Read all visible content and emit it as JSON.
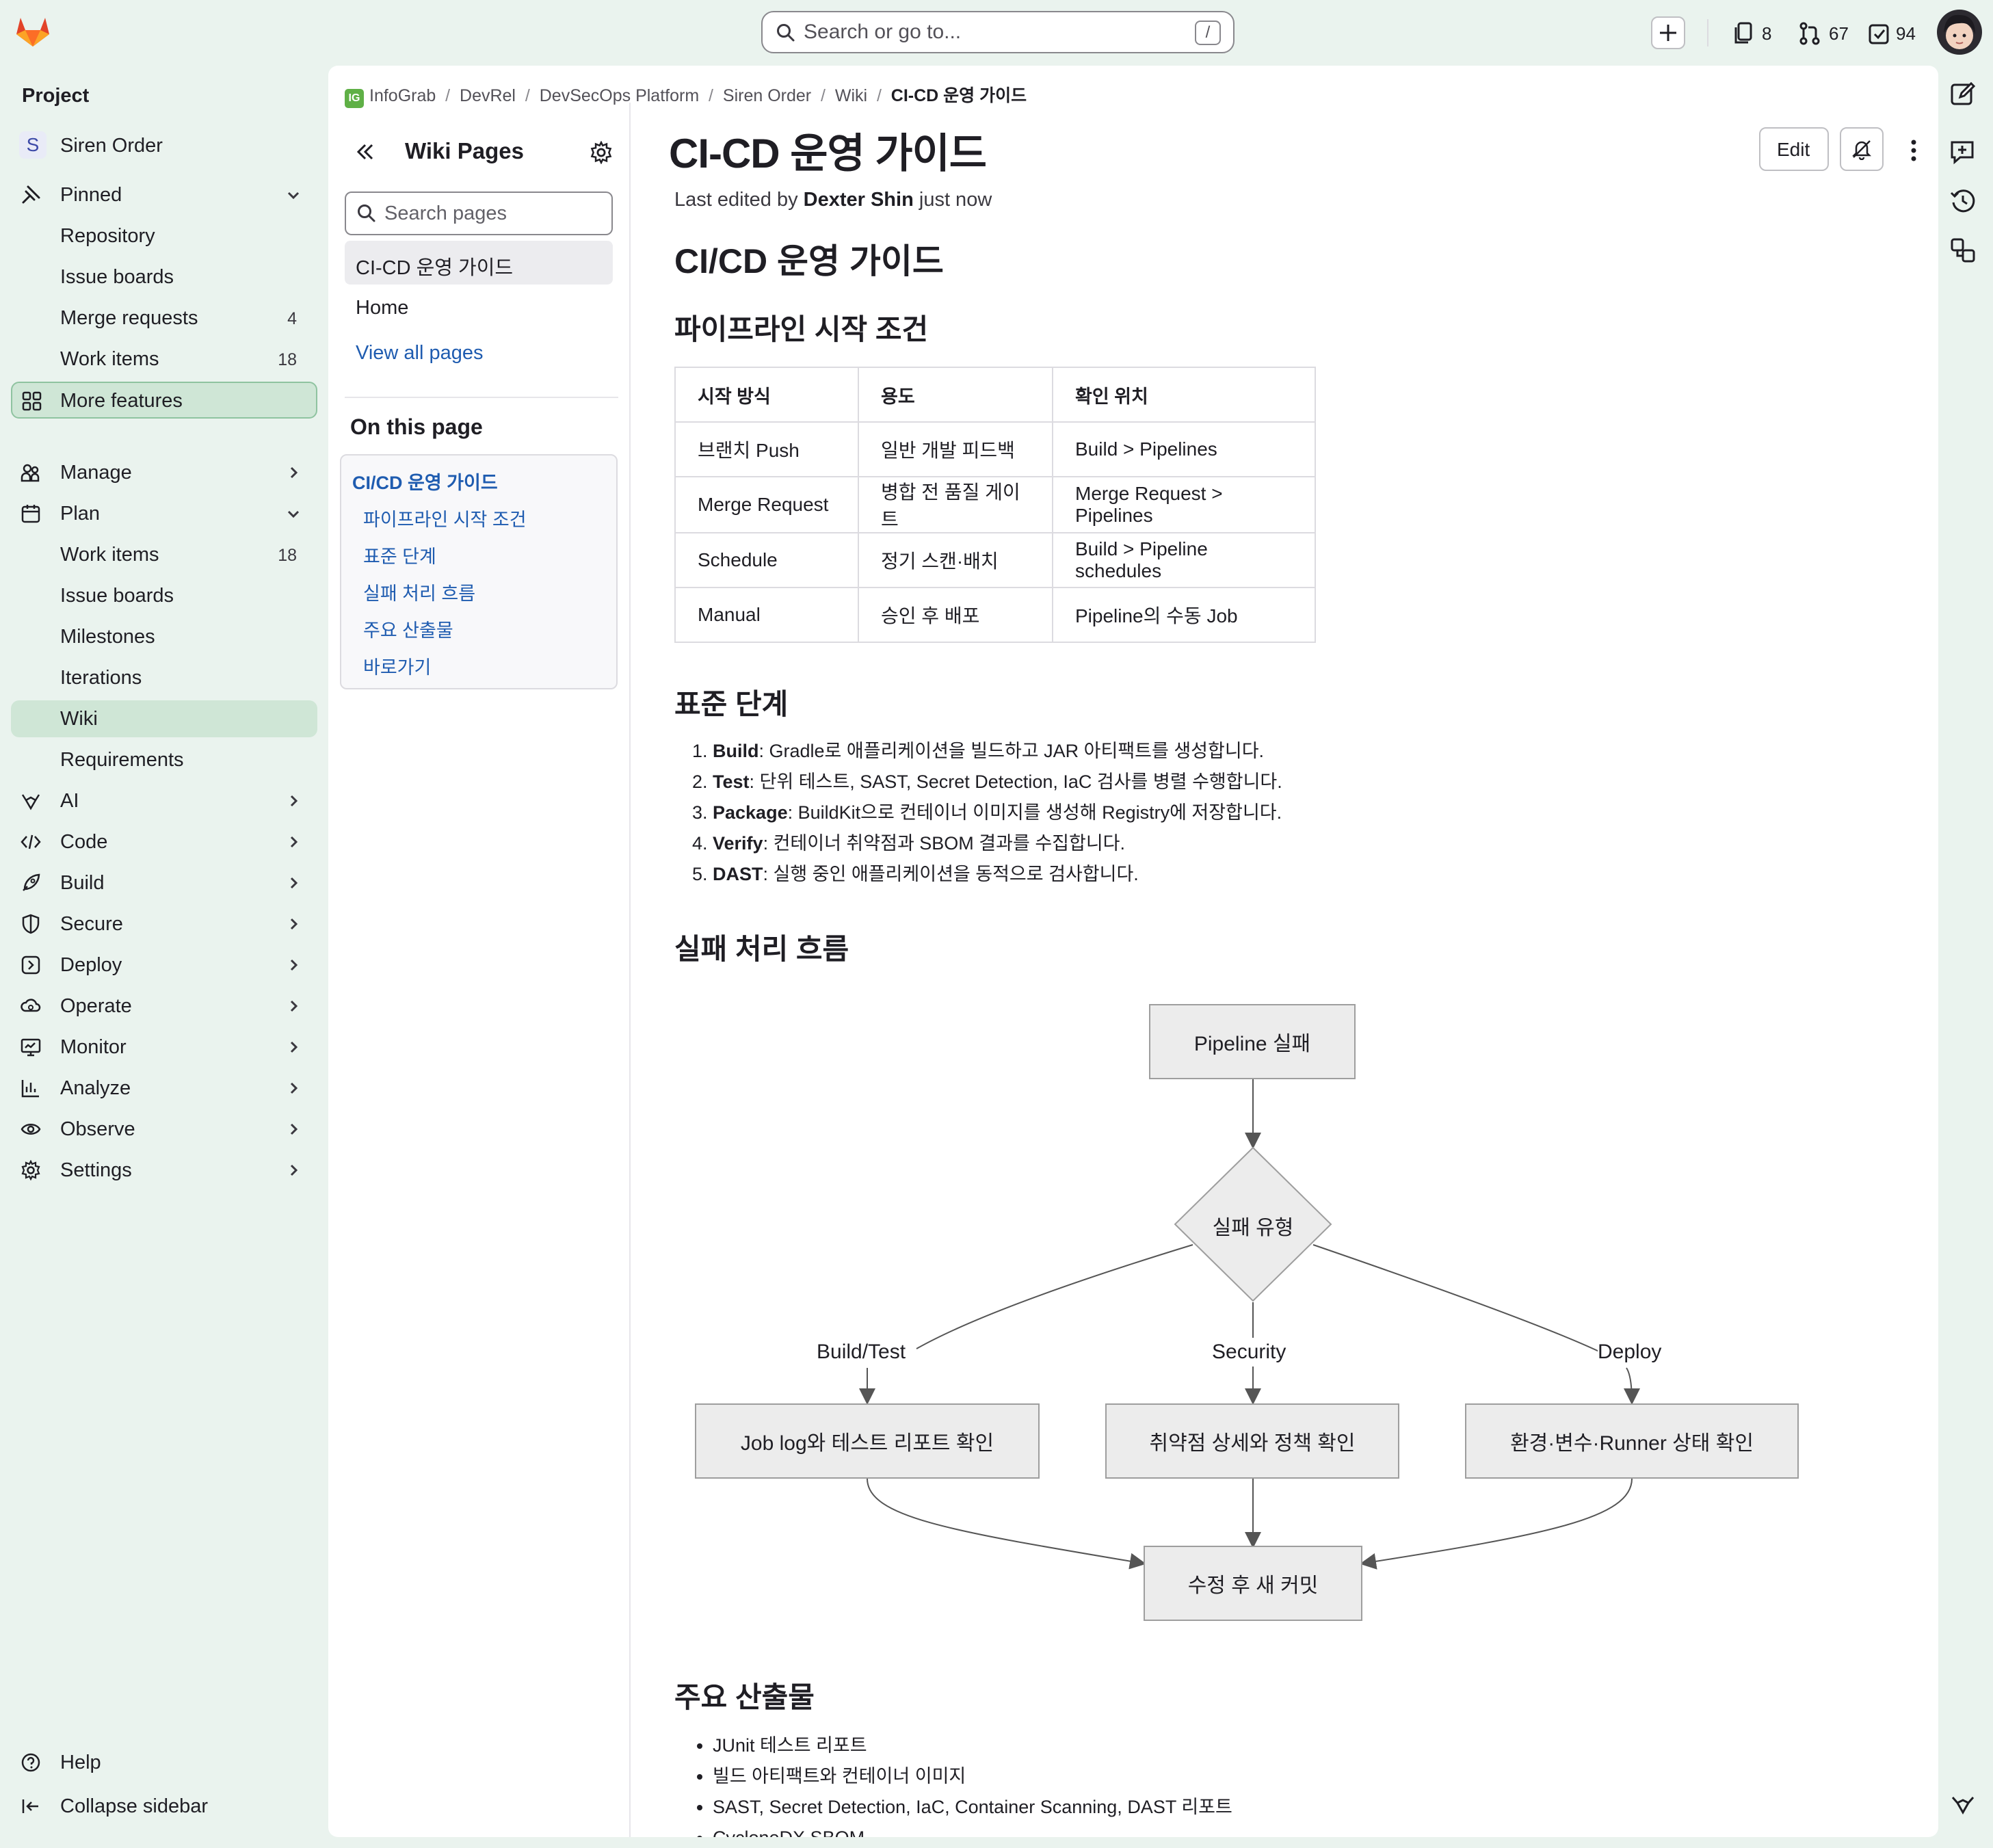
{
  "topbar": {
    "search_placeholder": "Search or go to...",
    "search_shortcut": "/",
    "issues_count": "8",
    "mr_count": "67",
    "todo_count": "94"
  },
  "sidebar": {
    "section_title": "Project",
    "project_initial": "S",
    "project_name": "Siren Order",
    "pinned_label": "Pinned",
    "pinned_items": [
      {
        "label": "Repository",
        "count": ""
      },
      {
        "label": "Issue boards",
        "count": ""
      },
      {
        "label": "Merge requests",
        "count": "4"
      },
      {
        "label": "Work items",
        "count": "18"
      }
    ],
    "more_features": "More features",
    "manage": "Manage",
    "plan": "Plan",
    "plan_items": [
      {
        "label": "Work items",
        "count": "18"
      },
      {
        "label": "Issue boards",
        "count": ""
      },
      {
        "label": "Milestones",
        "count": ""
      },
      {
        "label": "Iterations",
        "count": ""
      },
      {
        "label": "Wiki",
        "count": ""
      },
      {
        "label": "Requirements",
        "count": ""
      }
    ],
    "groups": [
      "AI",
      "Code",
      "Build",
      "Secure",
      "Deploy",
      "Operate",
      "Monitor",
      "Analyze",
      "Observe",
      "Settings"
    ],
    "help": "Help",
    "collapse": "Collapse sidebar"
  },
  "breadcrumb": [
    "InfoGrab",
    "DevRel",
    "DevSecOps Platform",
    "Siren Order",
    "Wiki",
    "CI-CD 운영 가이드"
  ],
  "wiki_nav": {
    "title": "Wiki Pages",
    "search_placeholder": "Search pages",
    "pages": [
      "CI-CD 운영 가이드",
      "Home"
    ],
    "view_all": "View all pages",
    "on_this_page": "On this page",
    "toc": [
      "CI/CD 운영 가이드",
      "파이프라인 시작 조건",
      "표준 단계",
      "실패 처리 흐름",
      "주요 산출물",
      "바로가기"
    ]
  },
  "page": {
    "title": "CI-CD 운영 가이드",
    "edit_label": "Edit",
    "last_edited_prefix": "Last edited by",
    "last_edited_author": "Dexter Shin",
    "last_edited_suffix": "just now",
    "h1": "CI/CD 운영 가이드",
    "h_start": "파이프라인 시작 조건",
    "table_headers": [
      "시작 방식",
      "용도",
      "확인 위치"
    ],
    "table_rows": [
      [
        "브랜치 Push",
        "일반 개발 피드백",
        "Build > Pipelines"
      ],
      [
        "Merge Request",
        "병합 전 품질 게이트",
        "Merge Request > Pipelines"
      ],
      [
        "Schedule",
        "정기 스캔·배치",
        "Build > Pipeline schedules"
      ],
      [
        "Manual",
        "승인 후 배포",
        "Pipeline의 수동 Job"
      ]
    ],
    "h_steps": "표준 단계",
    "steps": [
      {
        "name": "Build",
        "text": ": Gradle로 애플리케이션을 빌드하고 JAR 아티팩트를 생성합니다."
      },
      {
        "name": "Test",
        "text": ": 단위 테스트, SAST, Secret Detection, IaC 검사를 병렬 수행합니다."
      },
      {
        "name": "Package",
        "text": ": BuildKit으로 컨테이너 이미지를 생성해 Registry에 저장합니다."
      },
      {
        "name": "Verify",
        "text": ": 컨테이너 취약점과 SBOM 결과를 수집합니다."
      },
      {
        "name": "DAST",
        "text": ": 실행 중인 애플리케이션을 동적으로 검사합니다."
      }
    ],
    "h_failure": "실패 처리 흐름",
    "flow": {
      "start": "Pipeline 실패",
      "decision": "실패 유형",
      "edge_labels": [
        "Build/Test",
        "Security",
        "Deploy"
      ],
      "actions": [
        "Job log와 테스트 리포트 확인",
        "취약점 상세와 정책 확인",
        "환경·변수·Runner 상태 확인"
      ],
      "end": "수정 후 새 커밋"
    },
    "h_artifacts": "주요 산출물",
    "artifacts": [
      "JUnit 테스트 리포트",
      "빌드 아티팩트와 컨테이너 이미지",
      "SAST, Secret Detection, IaC, Container Scanning, DAST 리포트",
      "CycloneDX SBOM"
    ]
  },
  "colors": {
    "app_bg": "#eaf3ee",
    "link": "#1f5cb0",
    "active_nav": "#cfe6d6"
  }
}
